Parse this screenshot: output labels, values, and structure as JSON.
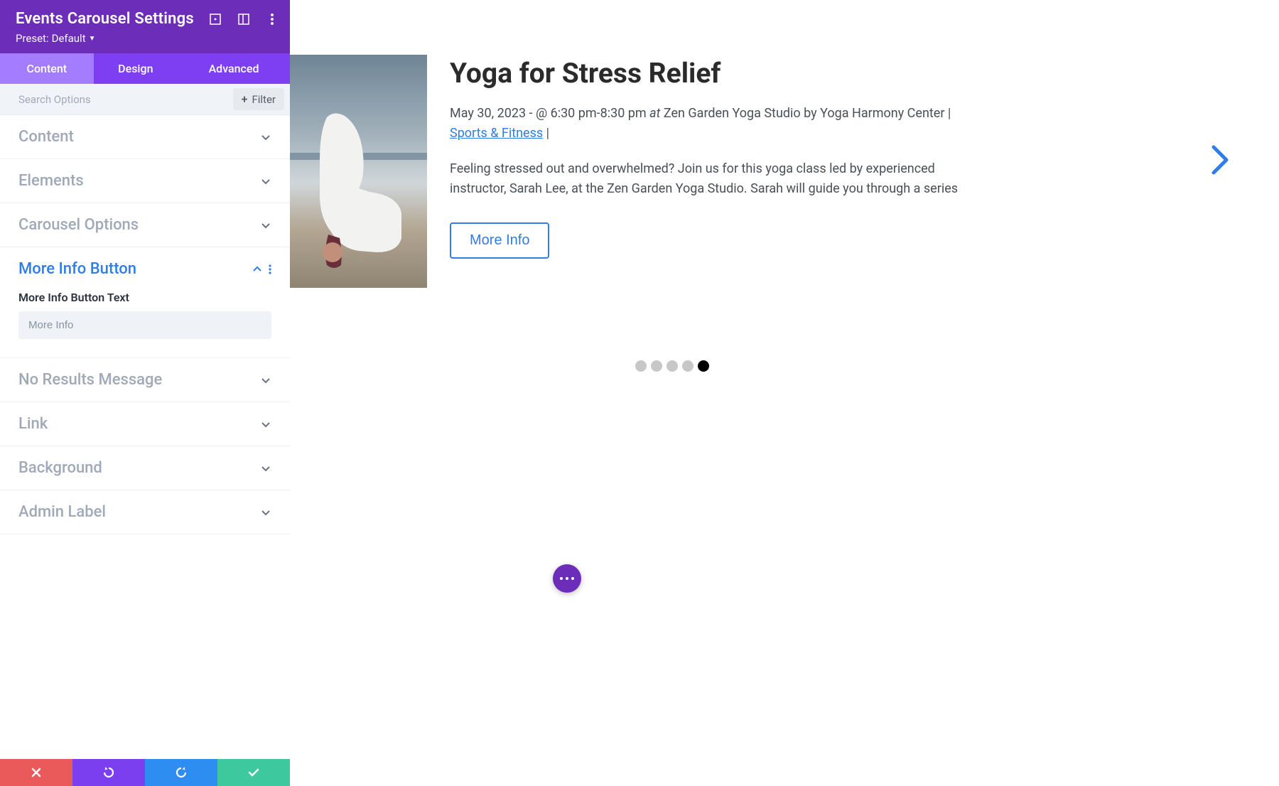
{
  "header": {
    "title": "Events Carousel Settings",
    "preset_label": "Preset:",
    "preset_value": "Default"
  },
  "tabs": {
    "content": "Content",
    "design": "Design",
    "advanced": "Advanced"
  },
  "search": {
    "placeholder": "Search Options",
    "filter_label": "Filter"
  },
  "sections": {
    "content": "Content",
    "elements": "Elements",
    "carousel_options": "Carousel Options",
    "more_info_button": "More Info Button",
    "no_results": "No Results Message",
    "link": "Link",
    "background": "Background",
    "admin_label": "Admin Label"
  },
  "more_info": {
    "field_label": "More Info Button Text",
    "value": "More Info"
  },
  "preview": {
    "title": "Yoga for Stress Relief",
    "date_time": "May 30, 2023 - @ 6:30 pm-8:30 pm",
    "at_word": "at",
    "venue": "Zen Garden Yoga Studio by Yoga Harmony Center",
    "sep1": " | ",
    "category": "Sports & Fitness",
    "sep2": " |",
    "description": "Feeling stressed out and overwhelmed? Join us for this yoga class led by experienced instructor, Sarah Lee, at the Zen Garden Yoga Studio. Sarah will guide you through a series",
    "button": "More Info",
    "dot_count": 5,
    "active_dot": 4
  },
  "colors": {
    "primary": "#6c2eb9",
    "tab_bg": "#7e3ff2",
    "tab_active": "#a47cff",
    "link_blue": "#2f7de9"
  }
}
